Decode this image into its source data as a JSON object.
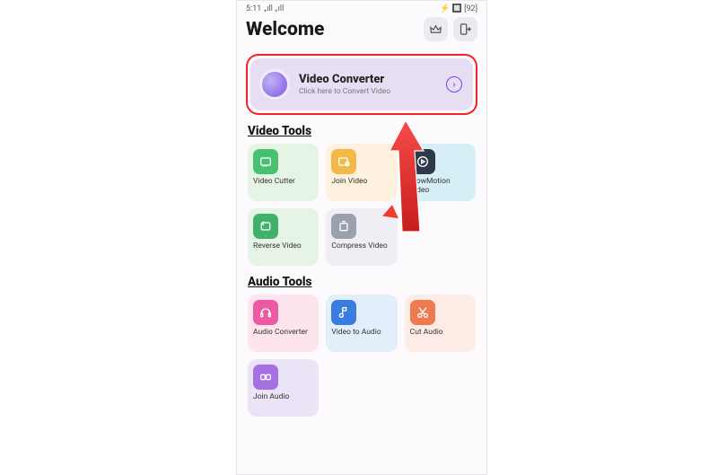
{
  "statusbar": {
    "time": "5:11",
    "signal": "₊ıll ₊ıll",
    "battery": "⚡ 🔲 [92]"
  },
  "header": {
    "title": "Welcome",
    "crown_icon": "crown",
    "logout_icon": "logout"
  },
  "main_card": {
    "title": "Video Converter",
    "subtitle": "Click here to Convert Video"
  },
  "sections": {
    "video_title": "Video Tools",
    "audio_title": "Audio Tools"
  },
  "video_tools": [
    {
      "label": "Video Cutter",
      "bg": "#e5f4e5",
      "icon_bg": "#47c06f"
    },
    {
      "label": "Join Video",
      "bg": "#fef2de",
      "icon_bg": "#f2b948"
    },
    {
      "label": "SlowMotion Video",
      "bg": "#d6eff6",
      "icon_bg": "#2e3a4a"
    },
    {
      "label": "Reverse Video",
      "bg": "#e5f4e5",
      "icon_bg": "#41b06a"
    },
    {
      "label": "Compress Video",
      "bg": "#efeef4",
      "icon_bg": "#9aa1ad",
      "flame": true
    }
  ],
  "audio_tools": [
    {
      "label": "Audio Converter",
      "bg": "#fde4ef",
      "icon_bg": "#ec5aa1"
    },
    {
      "label": "Video to Audio",
      "bg": "#e2effb",
      "icon_bg": "#3a7de0"
    },
    {
      "label": "Cut Audio",
      "bg": "#fdece6",
      "icon_bg": "#f07a4f"
    },
    {
      "label": "Join Audio",
      "bg": "#ebe3f6",
      "icon_bg": "#a66fe2"
    }
  ]
}
